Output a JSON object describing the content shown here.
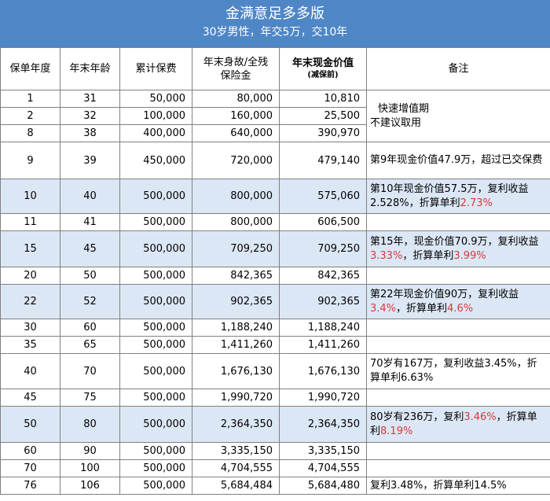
{
  "title": "金满意足多多版",
  "subtitle": "30岁男性，年交5万，交10年",
  "headers": {
    "year": "保单年度",
    "age": "年末年龄",
    "premium": "累计保费",
    "death_line1": "年末身故/全残",
    "death_line2": "保险金",
    "cash_line1": "年末现金价值",
    "cash_line2": "(减保前)",
    "note": "备注"
  },
  "rows": [
    {
      "year": "1",
      "age": "31",
      "premium": "50,000",
      "death": "80,000",
      "cash": "10,810"
    },
    {
      "year": "2",
      "age": "32",
      "premium": "100,000",
      "death": "160,000",
      "cash": "25,500"
    },
    {
      "year": "8",
      "age": "38",
      "premium": "400,000",
      "death": "640,000",
      "cash": "390,970"
    },
    {
      "year": "9",
      "age": "39",
      "premium": "450,000",
      "death": "720,000",
      "cash": "479,140"
    },
    {
      "year": "10",
      "age": "40",
      "premium": "500,000",
      "death": "800,000",
      "cash": "575,060"
    },
    {
      "year": "11",
      "age": "41",
      "premium": "500,000",
      "death": "800,000",
      "cash": "606,500"
    },
    {
      "year": "15",
      "age": "45",
      "premium": "500,000",
      "death": "709,250",
      "cash": "709,250"
    },
    {
      "year": "20",
      "age": "50",
      "premium": "500,000",
      "death": "842,365",
      "cash": "842,365"
    },
    {
      "year": "22",
      "age": "52",
      "premium": "500,000",
      "death": "902,365",
      "cash": "902,365"
    },
    {
      "year": "30",
      "age": "60",
      "premium": "500,000",
      "death": "1,188,240",
      "cash": "1,188,240"
    },
    {
      "year": "35",
      "age": "65",
      "premium": "500,000",
      "death": "1,411,260",
      "cash": "1,411,260"
    },
    {
      "year": "40",
      "age": "70",
      "premium": "500,000",
      "death": "1,676,130",
      "cash": "1,676,130"
    },
    {
      "year": "45",
      "age": "75",
      "premium": "500,000",
      "death": "1,990,720",
      "cash": "1,990,720"
    },
    {
      "year": "50",
      "age": "80",
      "premium": "500,000",
      "death": "2,364,350",
      "cash": "2,364,350"
    },
    {
      "year": "60",
      "age": "90",
      "premium": "500,000",
      "death": "3,335,150",
      "cash": "3,335,150"
    },
    {
      "year": "70",
      "age": "100",
      "premium": "500,000",
      "death": "4,704,555",
      "cash": "4,704,555"
    },
    {
      "year": "76",
      "age": "106",
      "premium": "500,000",
      "death": "5,684,484",
      "cash": "5,684,480"
    }
  ],
  "notes": {
    "n1a": "快速增值期",
    "n1b": "不建议取用",
    "n9": "第9年现金价值47.9万，超过已交保费",
    "n10_a": "第10年现金价值57.5万，复利收益2.528%，折算单利",
    "n10_b": "2.73%",
    "n15_a": "第15年，现金价值70.9万，复利收益",
    "n15_b": "3.33%",
    "n15_c": "，折算单利",
    "n15_d": "3.99%",
    "n22_a": "第22年现金价值90万，复利收益",
    "n22_b": "3.4%",
    "n22_c": "，折算单利",
    "n22_d": "4.6%",
    "n40": "70岁有167万，复利收益3.45%，折算单利6.63%",
    "n50_a": "80岁有236万，复利",
    "n50_b": "3.46%",
    "n50_c": "，折算单利",
    "n50_d": "8.19%",
    "n76": "复利3.48%，折算单利14.5%"
  },
  "colors": {
    "title_bg": "#4f86c6",
    "highlight_row": "#dbe7f5",
    "red_text": "#d9383a"
  }
}
